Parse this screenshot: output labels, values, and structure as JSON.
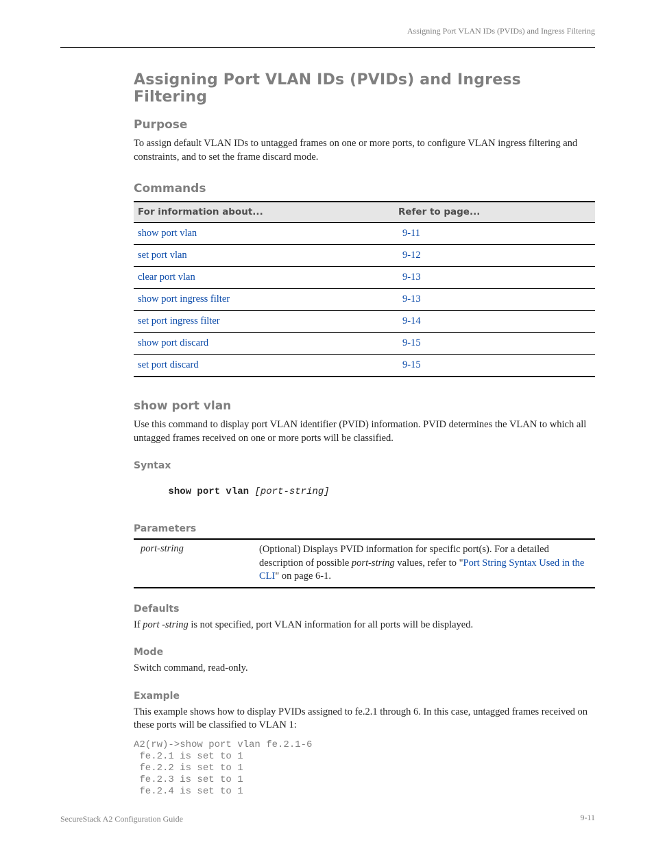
{
  "running_head": "Assigning Port VLAN IDs (PVIDs) and Ingress Filtering",
  "section_title": "Assigning Port VLAN IDs (PVIDs) and Ingress Filtering",
  "purpose_heading": "Purpose",
  "purpose_text": "To assign default VLAN IDs to untagged frames on one or more ports, to configure VLAN ingress filtering and constraints, and to set the frame discard mode.",
  "commands_heading": "Commands",
  "cmd_table": {
    "col1": "For information about...",
    "col2": "Refer to page...",
    "rows": [
      {
        "c1": "show port vlan",
        "c2": "9-11"
      },
      {
        "c1": "set port vlan",
        "c2": "9-12"
      },
      {
        "c1": "clear port vlan",
        "c2": "9-13"
      },
      {
        "c1": "show port ingress filter",
        "c2": "9-13"
      },
      {
        "c1": "set port ingress filter",
        "c2": "9-14"
      },
      {
        "c1": "show port discard",
        "c2": "9-15"
      },
      {
        "c1": "set port discard",
        "c2": "9-15"
      }
    ]
  },
  "cmd_heading": "show port vlan",
  "cmd_desc": "Use this command to display port VLAN identifier (PVID) information. PVID determines the VLAN to which all untagged frames received on one or more ports will be classified.",
  "syntax_heading": "Syntax",
  "syntax_prefix": "show port vlan ",
  "syntax_arg": "[port-string]",
  "params_heading": "Parameters",
  "param_name": "port-string",
  "param_desc_pre": "(Optional) Displays PVID information for specific port(s). For a detailed description of possible ",
  "param_desc_ital": "port-string",
  "param_desc_mid": " values, refer to \"",
  "param_desc_link": "Port String Syntax Used in the CLI",
  "param_desc_post": "\" on page 6-1.",
  "defaults_heading": "Defaults",
  "defaults_pre": "If ",
  "defaults_ital": "port -string",
  "defaults_post": " is not specified, port VLAN information for all ports will be displayed.",
  "mode_heading": "Mode",
  "mode_text": "Switch command, read-only.",
  "example_heading": "Example",
  "example_intro": "This example shows how to display PVIDs assigned to fe.2.1 through 6. In this case, untagged frames received on these ports will be classified to VLAN 1:",
  "example_block": "A2(rw)->show port vlan fe.2.1-6\n fe.2.1 is set to 1\n fe.2.2 is set to 1\n fe.2.3 is set to 1\n fe.2.4 is set to 1",
  "footer_left": "SecureStack A2 Configuration Guide",
  "footer_right": "9-11"
}
